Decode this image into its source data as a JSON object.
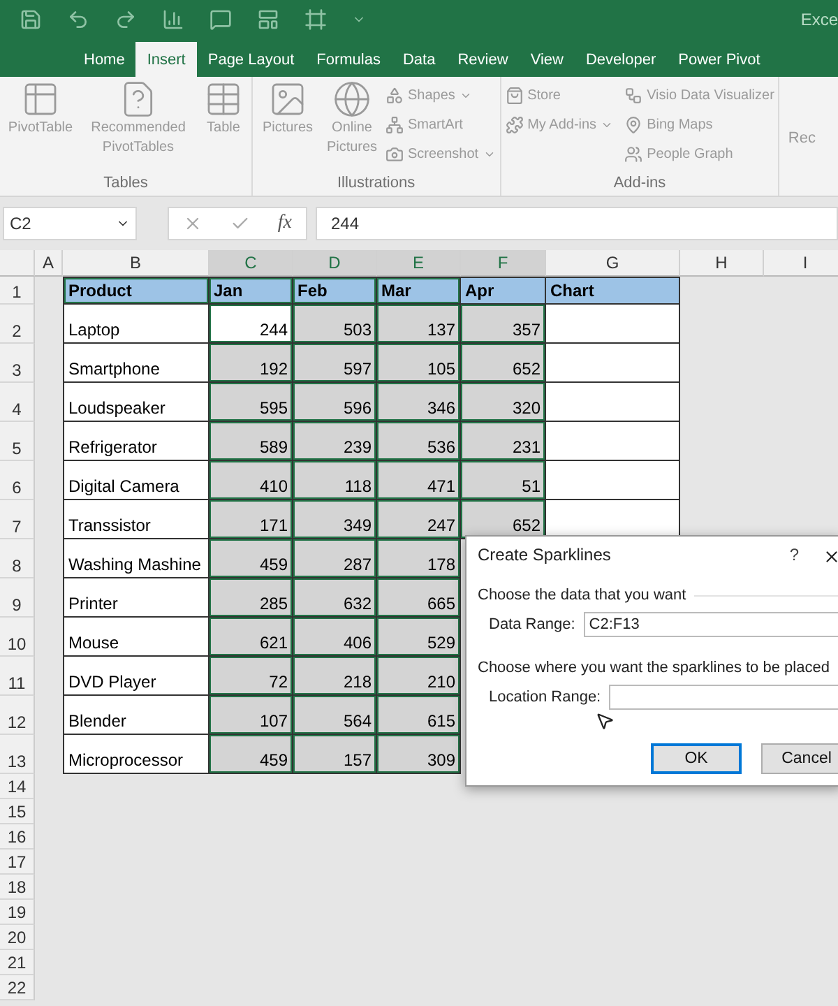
{
  "title_bar": {
    "title": "Exce"
  },
  "tabs": [
    {
      "label": "Home",
      "selected": false
    },
    {
      "label": "Insert",
      "selected": true
    },
    {
      "label": "Page Layout",
      "selected": false
    },
    {
      "label": "Formulas",
      "selected": false
    },
    {
      "label": "Data",
      "selected": false
    },
    {
      "label": "Review",
      "selected": false
    },
    {
      "label": "View",
      "selected": false
    },
    {
      "label": "Developer",
      "selected": false
    },
    {
      "label": "Power Pivot",
      "selected": false
    }
  ],
  "ribbon": {
    "groups": [
      {
        "label": "Tables",
        "large": [
          {
            "kind": "pivot",
            "label": "PivotTable"
          },
          {
            "kind": "recommended",
            "label": "Recommended PivotTables"
          },
          {
            "kind": "table",
            "label": "Table"
          }
        ]
      },
      {
        "label": "Illustrations",
        "large": [
          {
            "kind": "pictures",
            "label": "Pictures"
          },
          {
            "kind": "online",
            "label": "Online Pictures"
          }
        ],
        "small": [
          {
            "kind": "shapes",
            "label": "Shapes",
            "dropdown": true
          },
          {
            "kind": "smartart",
            "label": "SmartArt",
            "dropdown": false
          },
          {
            "kind": "screenshot",
            "label": "Screenshot",
            "dropdown": true
          }
        ]
      },
      {
        "label": "Add-ins",
        "small": [
          {
            "kind": "store",
            "label": "Store",
            "dropdown": false
          },
          {
            "kind": "addins",
            "label": "My Add-ins",
            "dropdown": true
          }
        ],
        "small2": [
          {
            "kind": "visio",
            "label": "Visio Data Visualizer"
          },
          {
            "kind": "bing",
            "label": "Bing Maps"
          },
          {
            "kind": "people",
            "label": "People Graph"
          }
        ]
      }
    ],
    "cut_label": "Rec"
  },
  "formula_bar": {
    "name_box": "C2",
    "fx": "fx",
    "value": "244"
  },
  "sheet": {
    "columns": [
      {
        "label": "A",
        "selected": false
      },
      {
        "label": "B",
        "selected": false
      },
      {
        "label": "C",
        "selected": true
      },
      {
        "label": "D",
        "selected": true
      },
      {
        "label": "E",
        "selected": true
      },
      {
        "label": "F",
        "selected": true
      },
      {
        "label": "G",
        "selected": false
      },
      {
        "label": "H",
        "selected": false
      },
      {
        "label": "I",
        "selected": false
      }
    ],
    "row_numbers": [
      "1",
      "2",
      "3",
      "4",
      "5",
      "6",
      "7",
      "8",
      "9",
      "10",
      "11",
      "12",
      "13",
      "14",
      "15",
      "16",
      "17",
      "18",
      "19",
      "20",
      "21",
      "22"
    ],
    "header": [
      "Product",
      "Jan",
      "Feb",
      "Mar",
      "Apr",
      "Chart"
    ],
    "rows": [
      {
        "product": "Laptop",
        "values": [
          {
            "text": "244",
            "active": true
          },
          {
            "text": "503",
            "active": false
          },
          {
            "text": "137",
            "active": false
          },
          {
            "text": "357",
            "active": false
          }
        ]
      },
      {
        "product": "Smartphone",
        "values": [
          {
            "text": "192",
            "active": false
          },
          {
            "text": "597",
            "active": false
          },
          {
            "text": "105",
            "active": false
          },
          {
            "text": "652",
            "active": false
          }
        ]
      },
      {
        "product": "Loudspeaker",
        "values": [
          {
            "text": "595",
            "active": false
          },
          {
            "text": "596",
            "active": false
          },
          {
            "text": "346",
            "active": false
          },
          {
            "text": "320",
            "active": false
          }
        ]
      },
      {
        "product": "Refrigerator",
        "values": [
          {
            "text": "589",
            "active": false
          },
          {
            "text": "239",
            "active": false
          },
          {
            "text": "536",
            "active": false
          },
          {
            "text": "231",
            "active": false
          }
        ]
      },
      {
        "product": "Digital Camera",
        "values": [
          {
            "text": "410",
            "active": false
          },
          {
            "text": "118",
            "active": false
          },
          {
            "text": "471",
            "active": false
          },
          {
            "text": "51",
            "active": false
          }
        ]
      },
      {
        "product": "Transsistor",
        "values": [
          {
            "text": "171",
            "active": false
          },
          {
            "text": "349",
            "active": false
          },
          {
            "text": "247",
            "active": false
          },
          {
            "text": "652",
            "active": false
          }
        ]
      },
      {
        "product": "Washing Mashine",
        "values": [
          {
            "text": "459",
            "active": false
          },
          {
            "text": "287",
            "active": false
          },
          {
            "text": "178",
            "active": false
          }
        ]
      },
      {
        "product": "Printer",
        "values": [
          {
            "text": "285",
            "active": false
          },
          {
            "text": "632",
            "active": false
          },
          {
            "text": "665",
            "active": false
          }
        ]
      },
      {
        "product": "Mouse",
        "values": [
          {
            "text": "621",
            "active": false
          },
          {
            "text": "406",
            "active": false
          },
          {
            "text": "529",
            "active": false
          }
        ]
      },
      {
        "product": "DVD Player",
        "values": [
          {
            "text": "72",
            "active": false
          },
          {
            "text": "218",
            "active": false
          },
          {
            "text": "210",
            "active": false
          }
        ]
      },
      {
        "product": "Blender",
        "values": [
          {
            "text": "107",
            "active": false
          },
          {
            "text": "564",
            "active": false
          },
          {
            "text": "615",
            "active": false
          }
        ]
      },
      {
        "product": "Microprocessor",
        "values": [
          {
            "text": "459",
            "active": false
          },
          {
            "text": "157",
            "active": false
          },
          {
            "text": "309",
            "active": false
          }
        ]
      }
    ]
  },
  "dialog": {
    "title": "Create Sparklines",
    "help": "?",
    "section_1": "Choose the data that you want",
    "data_range": {
      "label": "Data Range:",
      "value": "C2:F13"
    },
    "section_2": "Choose where you want the sparklines to be placed",
    "location_range": {
      "label": "Location Range:"
    },
    "buttons": [
      {
        "label": "OK",
        "selected": true
      },
      {
        "label": "Cancel",
        "selected": false
      }
    ]
  }
}
